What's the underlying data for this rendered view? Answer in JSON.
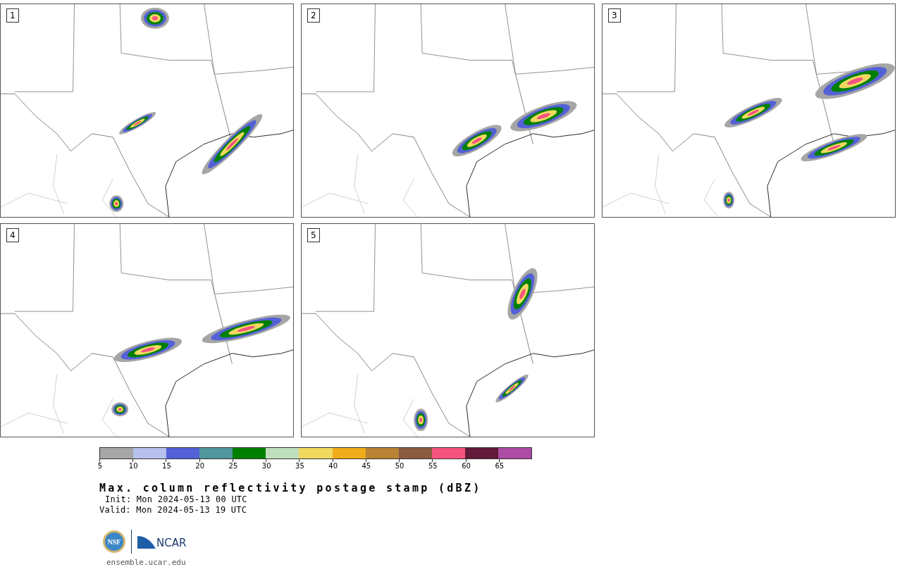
{
  "panels": [
    {
      "number": "1"
    },
    {
      "number": "2"
    },
    {
      "number": "3"
    },
    {
      "number": "4"
    },
    {
      "number": "5"
    }
  ],
  "legend": {
    "segments": [
      {
        "color": "#a6a6a6"
      },
      {
        "color": "#b7c1ec"
      },
      {
        "color": "#5461d6"
      },
      {
        "color": "#50969d"
      },
      {
        "color": "#008000"
      },
      {
        "color": "#bfdebd"
      },
      {
        "color": "#efd95f"
      },
      {
        "color": "#efac1b"
      },
      {
        "color": "#ba8233"
      },
      {
        "color": "#8b5b40"
      },
      {
        "color": "#f55380"
      },
      {
        "color": "#621a39"
      },
      {
        "color": "#ad4ca3"
      }
    ],
    "ticks": [
      "5",
      "10",
      "15",
      "20",
      "25",
      "30",
      "35",
      "40",
      "45",
      "50",
      "55",
      "60",
      "65"
    ]
  },
  "title": "Max. column reflectivity postage stamp (dBZ)",
  "init": "Init: Mon 2024-05-13 00 UTC",
  "valid": "Valid: Mon 2024-05-13 19 UTC",
  "logos": {
    "nsf": "NSF",
    "ncar": "NCAR"
  },
  "link": "ensemble.ucar.edu"
}
